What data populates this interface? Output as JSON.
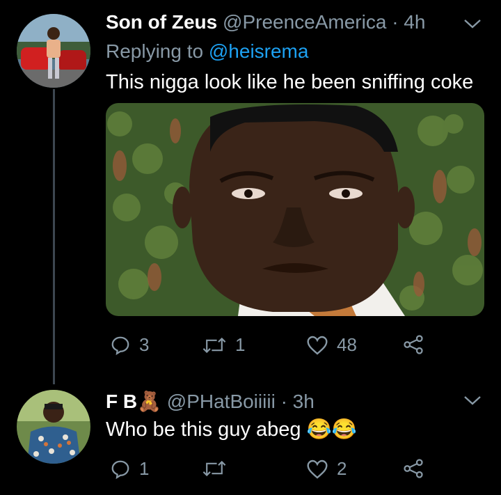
{
  "tweet1": {
    "display_name": "Son of Zeus",
    "handle": "@PreenceAmerica",
    "time": "· 4h",
    "replying_prefix": "Replying to",
    "replying_mention": "@heisrema",
    "text": "This nigga look like he been sniffing coke",
    "actions": {
      "replies": "3",
      "retweets": "1",
      "likes": "48"
    }
  },
  "tweet2": {
    "display_name": "F B",
    "emoji": "🧸",
    "handle": "@PHatBoiiiii",
    "time": "· 3h",
    "text": "Who be this guy abeg",
    "text_emoji": "😂😂",
    "actions": {
      "replies": "1",
      "retweets": "",
      "likes": "2"
    }
  },
  "icons": [
    "reply-icon",
    "retweet-icon",
    "like-icon",
    "share-icon",
    "chevron-down-icon"
  ],
  "colors": {
    "background": "#000000",
    "muted": "#8899a6",
    "link": "#1da1f2",
    "thread_line": "#3d4650"
  }
}
